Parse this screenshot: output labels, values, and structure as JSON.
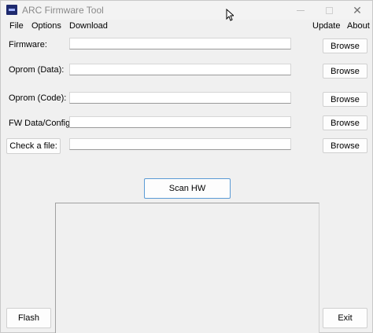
{
  "window": {
    "title": "ARC Firmware Tool",
    "minimize_label": "",
    "maximize_label": "",
    "close_label": "✕"
  },
  "menubar": {
    "file": "File",
    "options": "Options",
    "download": "Download",
    "update": "Update",
    "about": "About"
  },
  "rows": [
    {
      "label": "Firmware:",
      "value": "",
      "button": "Browse"
    },
    {
      "label": "Oprom (Data):",
      "value": "",
      "button": "Browse"
    },
    {
      "label": "Oprom (Code):",
      "value": "",
      "button": "Browse"
    },
    {
      "label": "FW Data/Config:",
      "value": "",
      "button": "Browse"
    },
    {
      "label": "Check a file:",
      "value": "",
      "button": "Browse"
    }
  ],
  "actions": {
    "scan": "Scan HW",
    "flash": "Flash",
    "exit": "Exit"
  },
  "output": {
    "text": ""
  },
  "colors": {
    "window_bg": "#f0f0f0",
    "icon_bg": "#1e2a6e",
    "scan_border": "#5b9bd5"
  }
}
